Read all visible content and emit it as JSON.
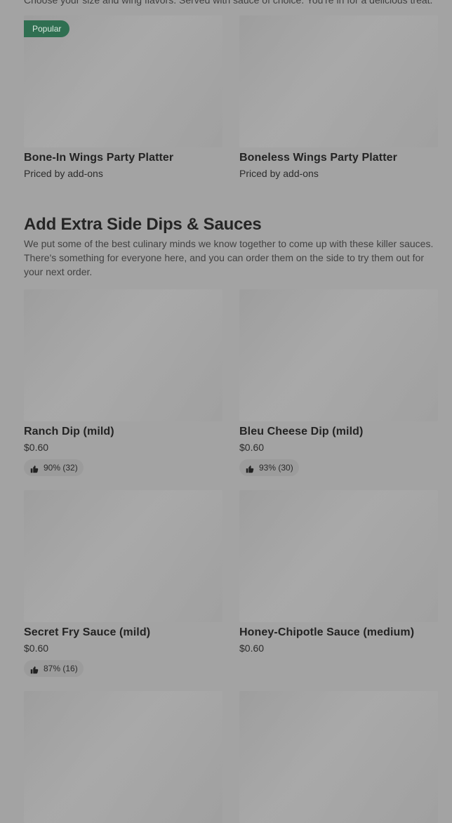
{
  "top_text": "Choose your size and wing flavors. Served with sauce of choice. You're in for a delicious treat.",
  "top_cards": [
    {
      "badge": "Popular",
      "title": "Bone-In Wings Party Platter",
      "subtitle": "Priced by add-ons"
    },
    {
      "title": "Boneless Wings Party Platter",
      "subtitle": "Priced by add-ons"
    }
  ],
  "section": {
    "title": "Add Extra Side Dips & Sauces",
    "description": "We put some of the best culinary minds we know together to come up with these killer sauces. There's something for everyone here, and you can order them on the side to try them out for your next order."
  },
  "items": [
    {
      "title": "Ranch Dip (mild)",
      "price": "$0.60",
      "rating": "90% (32)"
    },
    {
      "title": "Bleu Cheese Dip (mild)",
      "price": "$0.60",
      "rating": "93% (30)"
    },
    {
      "title": "Secret Fry Sauce (mild)",
      "price": "$0.60",
      "rating": "87% (16)"
    },
    {
      "title": "Honey-Chipotle Sauce (medium)",
      "price": "$0.60"
    }
  ],
  "colors": {
    "overlay_gray": "#a3a3a3",
    "badge_green": "#2f6f51"
  },
  "icons": {
    "rating": "thumbs-up-icon"
  }
}
